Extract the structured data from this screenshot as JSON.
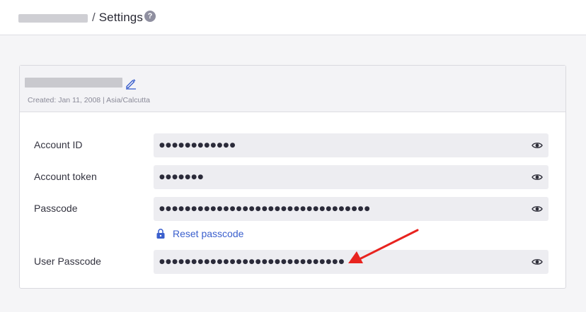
{
  "header": {
    "breadcrumb_separator": "/",
    "title": "Settings",
    "help_glyph": "?"
  },
  "account": {
    "meta": "Created: Jan 11, 2008 | Asia/Calcutta"
  },
  "fields": [
    {
      "label": "Account ID",
      "masked": "●●●●●●●●●●●●"
    },
    {
      "label": "Account token",
      "masked": "●●●●●●●"
    },
    {
      "label": "Passcode",
      "masked": "●●●●●●●●●●●●●●●●●●●●●●●●●●●●●●●●●"
    },
    {
      "label": "User Passcode",
      "masked": "●●●●●●●●●●●●●●●●●●●●●●●●●●●●●"
    }
  ],
  "reset_passcode": {
    "label": "Reset passcode"
  },
  "colors": {
    "accent": "#3a5fcd",
    "annotation_arrow": "#e8231f",
    "field_bg": "#ededf1"
  },
  "icons": [
    "help-icon",
    "pencil-icon",
    "eye-icon",
    "lock-icon",
    "annotation-arrow"
  ]
}
